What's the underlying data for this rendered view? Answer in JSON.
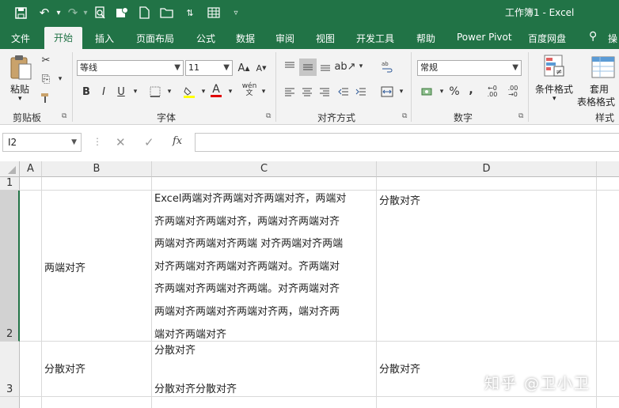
{
  "app": {
    "title": "工作簿1 - Excel",
    "accent": "#217346"
  },
  "quick_access": [
    "save-icon",
    "undo-icon",
    "redo-icon",
    "print-preview-icon",
    "save-as-icon",
    "new-file-icon",
    "open-folder-icon",
    "sort-icon",
    "table-icon",
    "customize-icon"
  ],
  "tabs": [
    {
      "label": "文件"
    },
    {
      "label": "开始"
    },
    {
      "label": "插入"
    },
    {
      "label": "页面布局"
    },
    {
      "label": "公式"
    },
    {
      "label": "数据"
    },
    {
      "label": "审阅"
    },
    {
      "label": "视图"
    },
    {
      "label": "开发工具"
    },
    {
      "label": "帮助"
    },
    {
      "label": "Power Pivot"
    },
    {
      "label": "百度网盘"
    },
    {
      "label": "操"
    }
  ],
  "ribbon": {
    "clipboard": {
      "paste_label": "粘贴",
      "group_label": "剪贴板"
    },
    "font": {
      "font_name": "等线",
      "font_size": "11",
      "bold": "B",
      "italic": "I",
      "underline": "U",
      "font_color_letter": "A",
      "grow": "A",
      "shrink": "A",
      "phonetic": "wén",
      "group_label": "字体"
    },
    "alignment": {
      "group_label": "对齐方式"
    },
    "number": {
      "format": "常规",
      "percent": "%",
      "comma": ",",
      "group_label": "数字"
    },
    "styles": {
      "conditional_label": "条件格式",
      "table_label_1": "套用",
      "table_label_2": "表格格式",
      "group_label": "样式"
    }
  },
  "formula_bar": {
    "name_box": "I2",
    "cancel": "✕",
    "enter": "✓",
    "fx": "fx",
    "value": ""
  },
  "grid": {
    "columns": [
      "A",
      "B",
      "C",
      "D"
    ],
    "rows": [
      "1",
      "2",
      "3"
    ],
    "cells": {
      "B2": "两端对齐",
      "C2": [
        "Excel两端对齐两端对齐两端对齐，两端对",
        "齐两端对齐两端对齐，两端对齐两端对齐",
        "两端对齐两端对齐两端 对齐两端对齐两端",
        "对齐两端对齐两端对齐两端对。齐两端对",
        "齐两端对齐两端对齐两端。对齐两端对齐",
        "两端对齐两端对齐两端对齐两，端对齐两",
        "端对齐两端对齐"
      ],
      "D2": "分散对齐",
      "B3": "分散对齐",
      "C3_top": "分散对齐",
      "C3_bottom": "分散对齐分散对齐",
      "D3": "分散对齐"
    }
  },
  "watermark": "知乎 @卫小卫"
}
